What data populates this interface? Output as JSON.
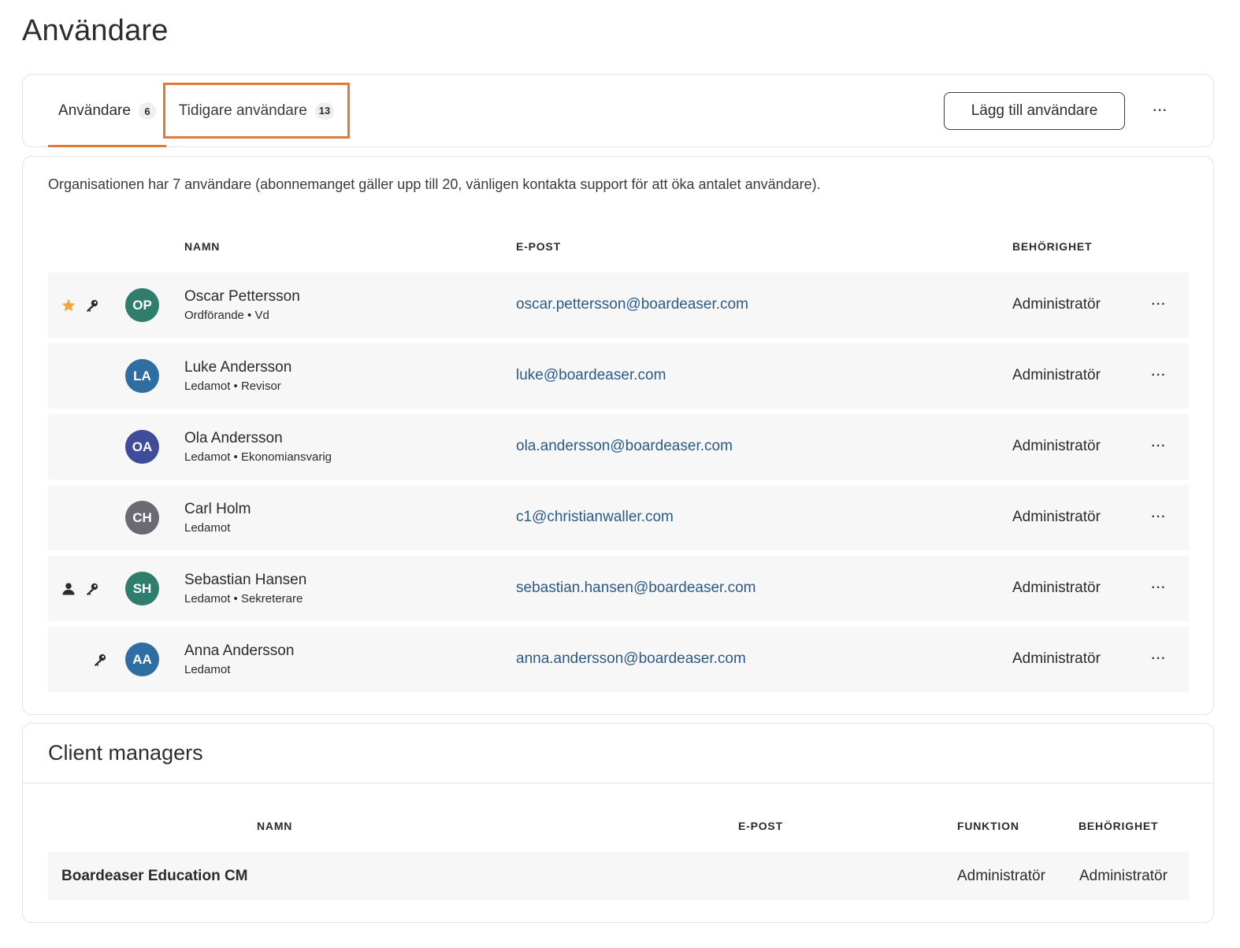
{
  "page": {
    "title": "Användare"
  },
  "tabs": [
    {
      "label": "Användare",
      "count": "6",
      "active": true
    },
    {
      "label": "Tidigare användare",
      "count": "13",
      "active": false
    }
  ],
  "toolbar": {
    "add_label": "Lägg till användare",
    "more_label": "···"
  },
  "users_section": {
    "info": "Organisationen har 7 användare (abonnemanget gäller upp till 20, vänligen kontakta support för att öka antalet användare).",
    "headers": {
      "name": "NAMN",
      "email": "E-POST",
      "permission": "BEHÖRIGHET"
    },
    "rows": [
      {
        "initials": "OP",
        "avatar_color": "#2f7d6d",
        "icons": [
          "star-icon",
          "key-icon"
        ],
        "name": "Oscar Pettersson",
        "role": "Ordförande • Vd",
        "email": "oscar.pettersson@boardeaser.com",
        "permission": "Administratör"
      },
      {
        "initials": "LA",
        "avatar_color": "#2e6ea3",
        "icons": [],
        "name": "Luke Andersson",
        "role": "Ledamot • Revisor",
        "email": "luke@boardeaser.com",
        "permission": "Administratör"
      },
      {
        "initials": "OA",
        "avatar_color": "#3f4c9a",
        "icons": [],
        "name": "Ola Andersson",
        "role": "Ledamot • Ekonomiansvarig",
        "email": "ola.andersson@boardeaser.com",
        "permission": "Administratör"
      },
      {
        "initials": "CH",
        "avatar_color": "#6b6a73",
        "icons": [],
        "name": "Carl Holm",
        "role": "Ledamot",
        "email": "c1@christianwaller.com",
        "permission": "Administratör"
      },
      {
        "initials": "SH",
        "avatar_color": "#2f7d6d",
        "icons": [
          "person-icon",
          "key-icon"
        ],
        "name": "Sebastian Hansen",
        "role": "Ledamot • Sekreterare",
        "email": "sebastian.hansen@boardeaser.com",
        "permission": "Administratör"
      },
      {
        "initials": "AA",
        "avatar_color": "#2e6ea3",
        "icons": [
          "key-icon"
        ],
        "name": "Anna Andersson",
        "role": "Ledamot",
        "email": "anna.andersson@boardeaser.com",
        "permission": "Administratör"
      }
    ]
  },
  "client_managers": {
    "title": "Client managers",
    "headers": {
      "name": "NAMN",
      "email": "E-POST",
      "function": "FUNKTION",
      "permission": "BEHÖRIGHET"
    },
    "rows": [
      {
        "name": "Boardeaser Education CM",
        "email": "",
        "function": "Administratör",
        "permission": "Administratör"
      }
    ]
  },
  "colors": {
    "accent": "#e07a3a",
    "link": "#2a5b8a",
    "star": "#f2a93b",
    "row_bg": "#f7f7f7"
  }
}
